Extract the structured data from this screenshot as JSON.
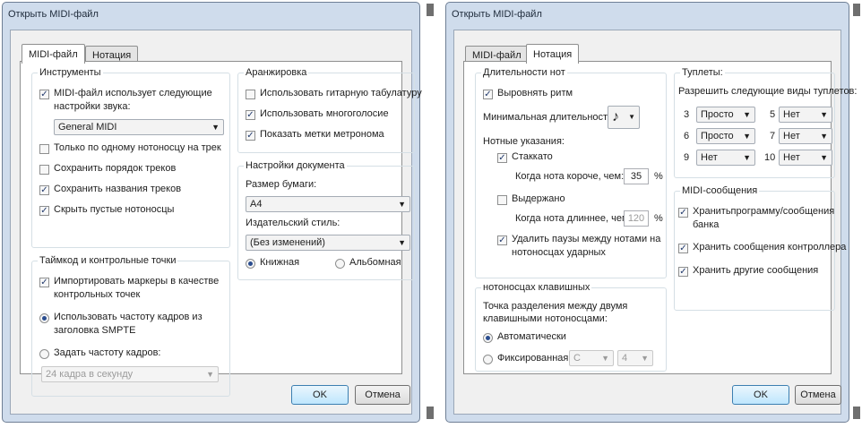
{
  "left": {
    "title": "Открыть MIDI-файл",
    "tabs": [
      "MIDI-файл",
      "Нотация"
    ],
    "instruments": {
      "title": "Инструменты",
      "uses_settings_1": "MIDI-файл использует следующие",
      "uses_settings_2": "настройки звука:",
      "sound_select": "General MIDI",
      "one_staff": "Только по одному нотоносцу на трек",
      "keep_order": "Сохранить порядок треков",
      "keep_names": "Сохранить названия треков",
      "hide_empty": "Скрыть пустые нотоносцы"
    },
    "timecode": {
      "title": "Таймкод и контрольные точки",
      "import_markers_1": "Импортировать маркеры в качестве",
      "import_markers_2": "контрольных точек",
      "use_smpte_1": "Использовать частоту кадров из",
      "use_smpte_2": "заголовка SMPTE",
      "set_rate": "Задать частоту кадров:",
      "rate_select": "24 кадра в секунду"
    },
    "arrangement": {
      "title": "Аранжировка",
      "guitar_tab": "Использовать гитарную табулатуру",
      "polyphony": "Использовать многоголосие",
      "metronome": "Показать метки метронома"
    },
    "document": {
      "title": "Настройки документа",
      "paper_label": "Размер бумаги:",
      "paper_select": "A4",
      "house_style_label": "Издательский стиль:",
      "house_style_select": "(Без изменений)",
      "portrait": "Книжная",
      "landscape": "Альбомная"
    },
    "ok": "OK",
    "cancel": "Отмена"
  },
  "right": {
    "title": "Открыть MIDI-файл",
    "tabs": [
      "MIDI-файл",
      "Нотация"
    ],
    "durations": {
      "title": "Длительности нот",
      "align_rhythm": "Выровнять ритм",
      "min_duration": "Минимальная длительность:",
      "note_glyph": "♪",
      "articulations": "Нотные указания:",
      "staccato": "Стаккато",
      "shorter_than": "Когда нота короче, чем:",
      "shorter_value": "35",
      "tenuto": "Выдержано",
      "longer_than": "Когда нота длиннее, чем:",
      "longer_value": "120",
      "percent": "%",
      "remove_rests_1": "Удалить паузы между нотами на",
      "remove_rests_2": "нотоносцах ударных"
    },
    "keyboard": {
      "title": "нотоносцах клавишных",
      "split_1": "Точка разделения между двумя",
      "split_2": "клавишными нотоносцами:",
      "auto": "Автоматически",
      "fixed": "Фиксированная",
      "note_select": "C",
      "octave_select": "4"
    },
    "tuplets": {
      "title": "Туплеты:",
      "allow": "Разрешить следующие виды туплетов:",
      "items": [
        {
          "n": "3",
          "v": "Просто"
        },
        {
          "n": "5",
          "v": "Нет"
        },
        {
          "n": "6",
          "v": "Просто"
        },
        {
          "n": "7",
          "v": "Нет"
        },
        {
          "n": "9",
          "v": "Нет"
        },
        {
          "n": "10",
          "v": "Нет"
        }
      ]
    },
    "midi_messages": {
      "title": "MIDI-сообщения",
      "program_1": "Хранитьпрограмму/сообщения",
      "program_2": "банка",
      "controller": "Хранить сообщения контроллера",
      "other": "Хранить другие сообщения"
    },
    "ok": "OK",
    "cancel": "Отмена"
  }
}
